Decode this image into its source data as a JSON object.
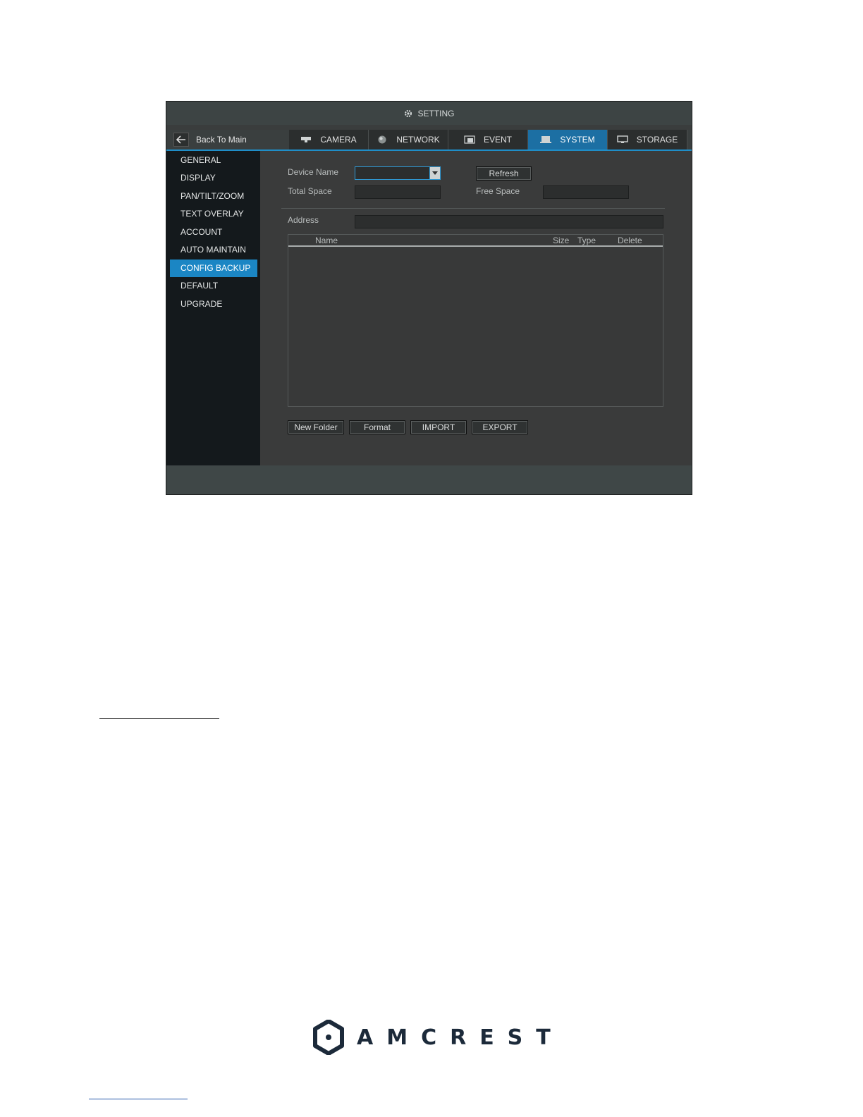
{
  "window": {
    "title": "SETTING",
    "back_label": "Back To Main"
  },
  "tabs": [
    {
      "label": "CAMERA",
      "icon": "camera-icon",
      "active": false
    },
    {
      "label": "NETWORK",
      "icon": "globe-icon",
      "active": false
    },
    {
      "label": "EVENT",
      "icon": "event-icon",
      "active": false
    },
    {
      "label": "SYSTEM",
      "icon": "system-icon",
      "active": true
    },
    {
      "label": "STORAGE",
      "icon": "monitor-icon",
      "active": false
    }
  ],
  "sidebar": {
    "items": [
      {
        "label": "GENERAL"
      },
      {
        "label": "DISPLAY"
      },
      {
        "label": "PAN/TILT/ZOOM"
      },
      {
        "label": "TEXT OVERLAY"
      },
      {
        "label": "ACCOUNT"
      },
      {
        "label": "AUTO MAINTAIN"
      },
      {
        "label": "CONFIG BACKUP"
      },
      {
        "label": "DEFAULT"
      },
      {
        "label": "UPGRADE"
      }
    ],
    "active": "CONFIG BACKUP"
  },
  "form": {
    "device_name_label": "Device Name",
    "device_name_value": "",
    "refresh_label": "Refresh",
    "total_space_label": "Total Space",
    "total_space_value": "",
    "free_space_label": "Free Space",
    "free_space_value": "",
    "address_label": "Address",
    "address_value": ""
  },
  "file_table": {
    "columns": [
      "Name",
      "Size",
      "Type",
      "Delete"
    ],
    "rows": []
  },
  "actions": {
    "new_folder": "New Folder",
    "format": "Format",
    "import": "IMPORT",
    "export": "EXPORT"
  },
  "brand": {
    "name": "AMCREST",
    "color": "#1c2a3a"
  },
  "colors": {
    "accent": "#1b86c4",
    "panel": "#3a3b3b",
    "sidebar": "#14191c"
  }
}
